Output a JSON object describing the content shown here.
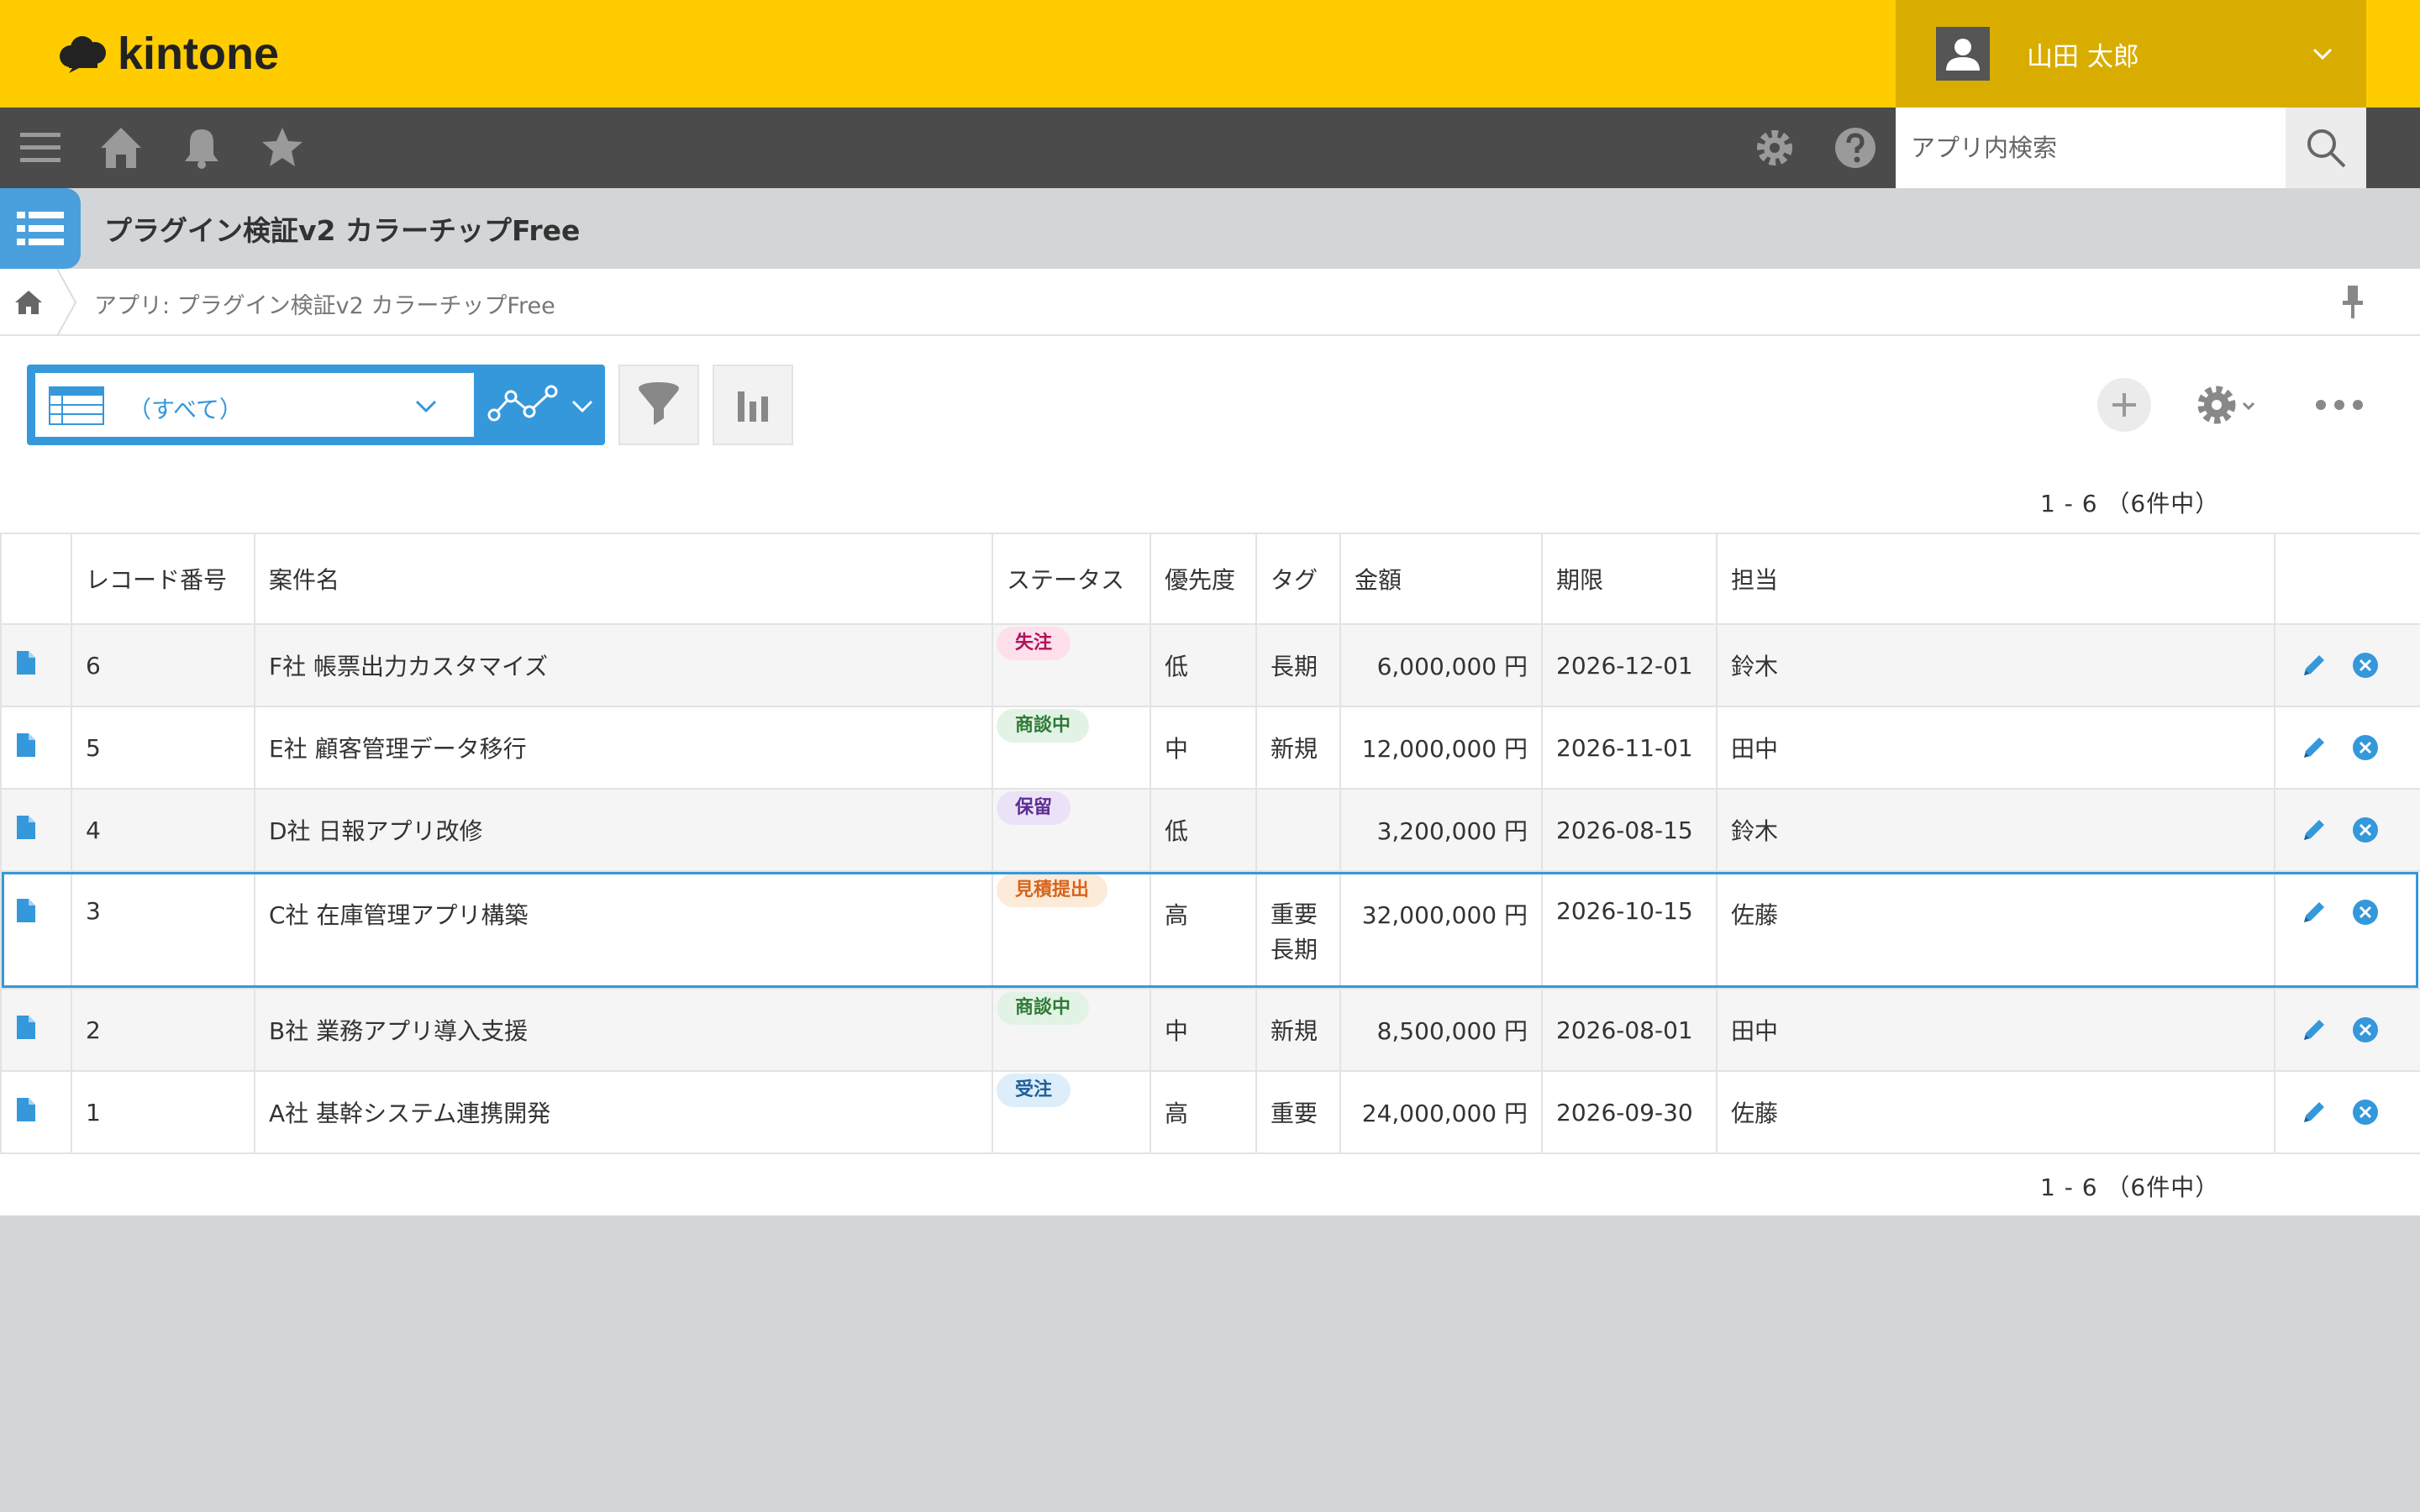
{
  "header": {
    "logo_text": "kintone",
    "user_name": "山田 太郎",
    "brand_color": "#ffcc00"
  },
  "navbar": {
    "icons": [
      "menu-icon",
      "home-icon",
      "bell-icon",
      "star-icon",
      "gear-icon",
      "help-icon"
    ],
    "search_placeholder": "アプリ内検索"
  },
  "app": {
    "title": "プラグイン検証v2 カラーチップFree",
    "breadcrumb": "アプリ: プラグイン検証v2 カラーチップFree"
  },
  "toolbar": {
    "view_label": "（すべて）"
  },
  "pagination": {
    "top": "1 - 6 （6件中）",
    "bottom": "1 - 6 （6件中）"
  },
  "table": {
    "columns": [
      "レコード番号",
      "案件名",
      "ステータス",
      "優先度",
      "タグ",
      "金額",
      "期限",
      "担当"
    ],
    "rows": [
      {
        "id": "6",
        "name": "F社 帳票出力カスタマイズ",
        "status": "失注",
        "status_bg": "#fde0ec",
        "status_fg": "#b0125a",
        "priority": "低",
        "tags": [
          "長期"
        ],
        "amount": "6,000,000 円",
        "due": "2026-12-01",
        "owner": "鈴木"
      },
      {
        "id": "5",
        "name": "E社 顧客管理データ移行",
        "status": "商談中",
        "status_bg": "#e2f3e5",
        "status_fg": "#2d7a36",
        "priority": "中",
        "tags": [
          "新規"
        ],
        "amount": "12,000,000 円",
        "due": "2026-11-01",
        "owner": "田中"
      },
      {
        "id": "4",
        "name": "D社 日報アプリ改修",
        "status": "保留",
        "status_bg": "#ece2f7",
        "status_fg": "#5a2d91",
        "priority": "低",
        "tags": [],
        "amount": "3,200,000 円",
        "due": "2026-08-15",
        "owner": "鈴木"
      },
      {
        "id": "3",
        "name": "C社 在庫管理アプリ構築",
        "status": "見積提出",
        "status_bg": "#fdebd9",
        "status_fg": "#d9631a",
        "priority": "高",
        "tags": [
          "重要",
          "長期"
        ],
        "amount": "32,000,000 円",
        "due": "2026-10-15",
        "owner": "佐藤"
      },
      {
        "id": "2",
        "name": "B社 業務アプリ導入支援",
        "status": "商談中",
        "status_bg": "#e2f3e5",
        "status_fg": "#2d7a36",
        "priority": "中",
        "tags": [
          "新規"
        ],
        "amount": "8,500,000 円",
        "due": "2026-08-01",
        "owner": "田中"
      },
      {
        "id": "1",
        "name": "A社 基幹システム連携開発",
        "status": "受注",
        "status_bg": "#ddeefa",
        "status_fg": "#1f5f99",
        "priority": "高",
        "tags": [
          "重要"
        ],
        "amount": "24,000,000 円",
        "due": "2026-09-30",
        "owner": "佐藤"
      }
    ]
  }
}
